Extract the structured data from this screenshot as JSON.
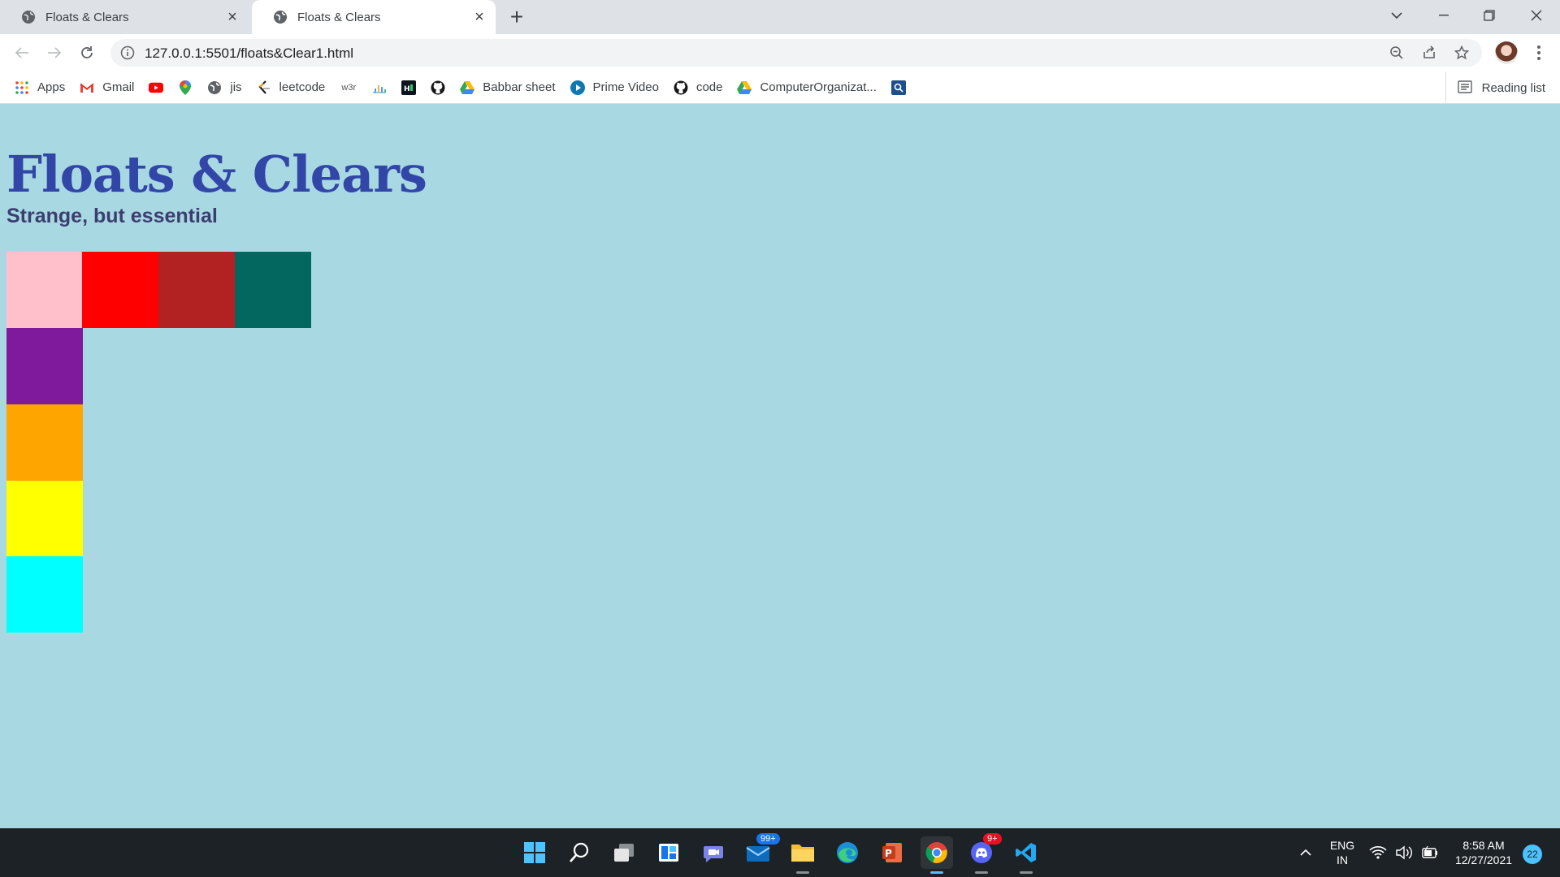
{
  "browser": {
    "tabs": [
      {
        "title": "Floats & Clears",
        "active": false
      },
      {
        "title": "Floats & Clears",
        "active": true
      }
    ],
    "url": "127.0.0.1:5501/floats&Clear1.html",
    "bookmarks": [
      {
        "label": "Apps",
        "icon": "apps-grid-icon"
      },
      {
        "label": "Gmail",
        "icon": "gmail-icon"
      },
      {
        "label": "",
        "icon": "youtube-icon"
      },
      {
        "label": "",
        "icon": "maps-pin-icon"
      },
      {
        "label": "jis",
        "icon": "globe-icon"
      },
      {
        "label": "leetcode",
        "icon": "leetcode-icon"
      },
      {
        "label": "",
        "icon": "w3schools-icon"
      },
      {
        "label": "",
        "icon": "chart-icon"
      },
      {
        "label": "",
        "icon": "hackerrank-icon"
      },
      {
        "label": "",
        "icon": "github-icon"
      },
      {
        "label": "Babbar sheet",
        "icon": "google-drive-icon"
      },
      {
        "label": "Prime Video",
        "icon": "prime-video-icon"
      },
      {
        "label": "code",
        "icon": "github-icon"
      },
      {
        "label": "ComputerOrganizat...",
        "icon": "google-drive-icon"
      },
      {
        "label": "",
        "icon": "search-box-icon"
      }
    ],
    "reading_list": "Reading list"
  },
  "page": {
    "title": "Floats & Clears",
    "subtitle": "Strange, but essential",
    "boxes": [
      {
        "color": "#ffc0cb"
      },
      {
        "color": "#ff0000"
      },
      {
        "color": "#b22222"
      },
      {
        "color": "#03665f"
      },
      {
        "color": "#7f1a9c"
      },
      {
        "color": "#ffa500"
      },
      {
        "color": "#ffff00"
      },
      {
        "color": "#00ffff"
      }
    ],
    "background": "#a8d9e3"
  },
  "taskbar": {
    "mail_badge": "99+",
    "discord_badge": "9+",
    "language": "ENG",
    "region": "IN",
    "time": "8:58 AM",
    "date": "12/27/2021",
    "notifications": "22"
  }
}
